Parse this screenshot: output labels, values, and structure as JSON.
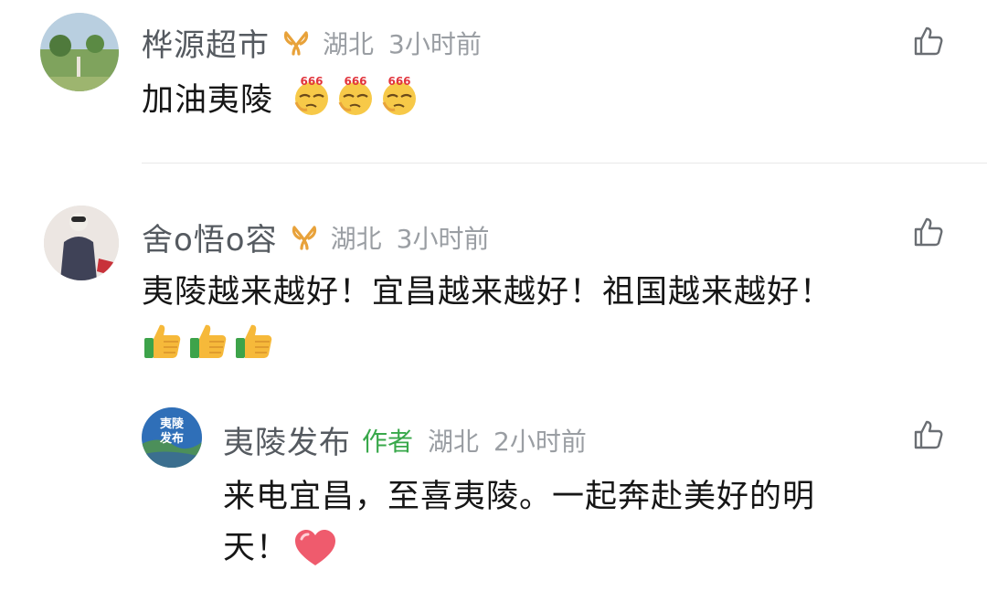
{
  "comments": [
    {
      "username": "桦源超市",
      "location": "湖北",
      "time": "3小时前",
      "text": "加油夷陵",
      "emoji": "666-emoji"
    },
    {
      "username": "舍o悟o容",
      "location": "湖北",
      "time": "3小时前",
      "text": "夷陵越来越好！宜昌越来越好！祖国越来越好！",
      "emoji": "thumbs-up-emoji"
    }
  ],
  "reply": {
    "username": "夷陵发布",
    "author_label": "作者",
    "location": "湖北",
    "time": "2小时前",
    "text_line1": "来电宜昌，至喜夷陵。一起奔赴美好的明",
    "text_line2": "天！",
    "avatar_text": "夷陵\n发布",
    "emoji": "heart-emoji"
  },
  "colors": {
    "username": "#555a60",
    "meta": "#9a9ea3",
    "author_badge": "#38a84a",
    "ribbon": "#e8a23a",
    "heart": "#ef5b6d"
  }
}
